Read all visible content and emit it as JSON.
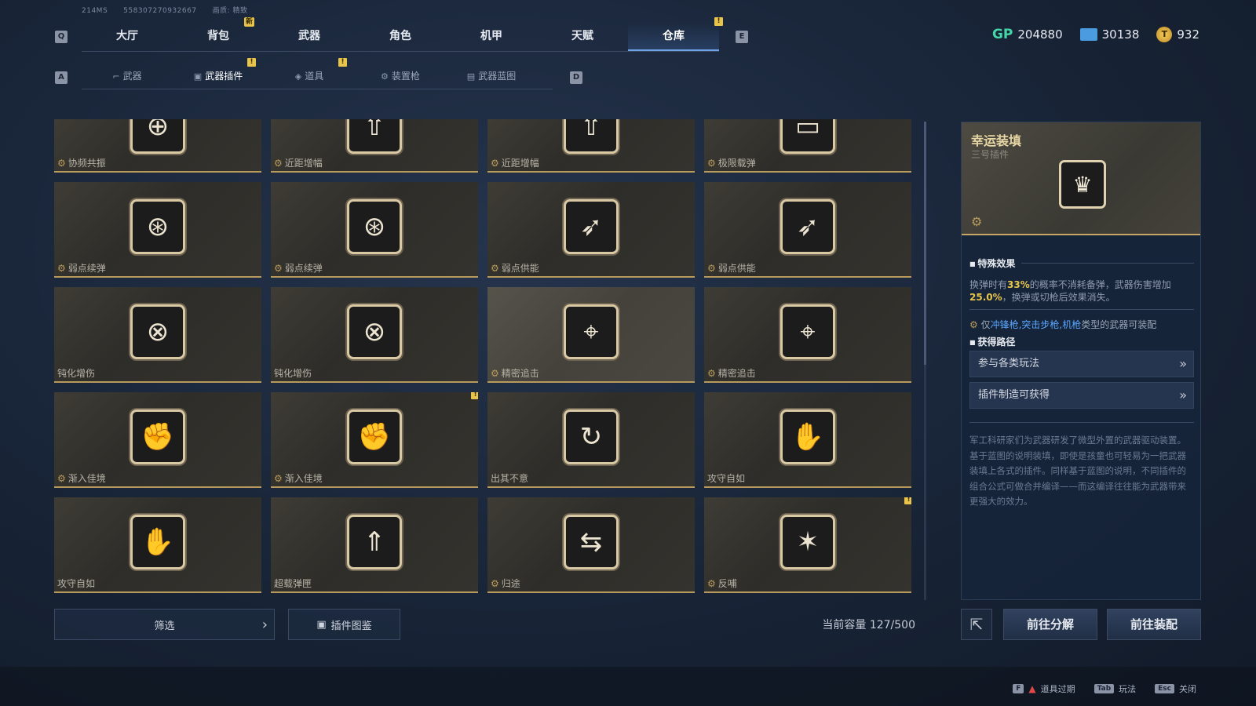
{
  "debug": {
    "ping": "214MS",
    "uid": "558307270932667",
    "quality": "画质: 精致"
  },
  "main_tabs": [
    "大厅",
    "背包",
    "武器",
    "角色",
    "机甲",
    "天赋",
    "仓库"
  ],
  "main_tab_badge": "新",
  "keys": {
    "prev_main": "Q",
    "next_main": "E",
    "prev_sub": "A",
    "next_sub": "D"
  },
  "currency": {
    "gp_icon": "GP",
    "gp": "204880",
    "ticket": "30138",
    "coin": "932"
  },
  "sub_tabs": [
    "武器",
    "武器插件",
    "道具",
    "装置枪",
    "武器蓝图"
  ],
  "grid": [
    {
      "label": "协频共振",
      "glyph": "⊕"
    },
    {
      "label": "近距增幅",
      "glyph": "⇧"
    },
    {
      "label": "近距增幅",
      "glyph": "⇧"
    },
    {
      "label": "极限载弹",
      "glyph": "▭"
    },
    {
      "label": "弱点续弹",
      "glyph": "⊛"
    },
    {
      "label": "弱点续弹",
      "glyph": "⊛"
    },
    {
      "label": "弱点供能",
      "glyph": "➶"
    },
    {
      "label": "弱点供能",
      "glyph": "➶"
    },
    {
      "label": "钝化增伤",
      "glyph": "⊗"
    },
    {
      "label": "钝化增伤",
      "glyph": "⊗"
    },
    {
      "label": "精密追击",
      "glyph": "⌖"
    },
    {
      "label": "精密追击",
      "glyph": "⌖"
    },
    {
      "label": "渐入佳境",
      "glyph": "✊"
    },
    {
      "label": "渐入佳境",
      "glyph": "✊"
    },
    {
      "label": "出其不意",
      "glyph": "↻"
    },
    {
      "label": "攻守自如",
      "glyph": "✋"
    },
    {
      "label": "攻守自如",
      "glyph": "✋"
    },
    {
      "label": "超载弹匣",
      "glyph": "⇑"
    },
    {
      "label": "归途",
      "glyph": "⇆"
    },
    {
      "label": "反哺",
      "glyph": "✶"
    }
  ],
  "bottom": {
    "filter": "筛选",
    "codex": "插件图鉴",
    "capacity": "当前容量 127/500"
  },
  "detail": {
    "title": "幸运装填",
    "subtitle": "三号插件",
    "glyph": "♛",
    "effect_section": "特殊效果",
    "effect_pre": "换弹时有",
    "effect_pct1": "33%",
    "effect_mid": "的概率不消耗备弹，武器伤害增加",
    "effect_pct2": "25.0%",
    "effect_post": "，换弹或切枪后效果消失。",
    "req_pre": "仅",
    "req_types": "冲锋枪,突击步枪,机枪",
    "req_post": "类型的武器可装配",
    "source_section": "获得路径",
    "sources": [
      "参与各类玩法",
      "插件制造可获得"
    ],
    "lore": "军工科研家们为武器研发了微型外置的武器驱动装置。基于蓝图的说明装填，即使是孩童也可轻易为一把武器装填上各式的插件。同样基于蓝图的说明，不同插件的组合公式可做合并编译——而这编译往往能为武器带来更强大的效力。"
  },
  "actions": {
    "disassemble": "前往分解",
    "equip": "前往装配"
  },
  "hints": [
    {
      "key": "F",
      "label": "道具过期"
    },
    {
      "key": "Tab",
      "label": "玩法"
    },
    {
      "key": "Esc",
      "label": "关闭"
    }
  ]
}
